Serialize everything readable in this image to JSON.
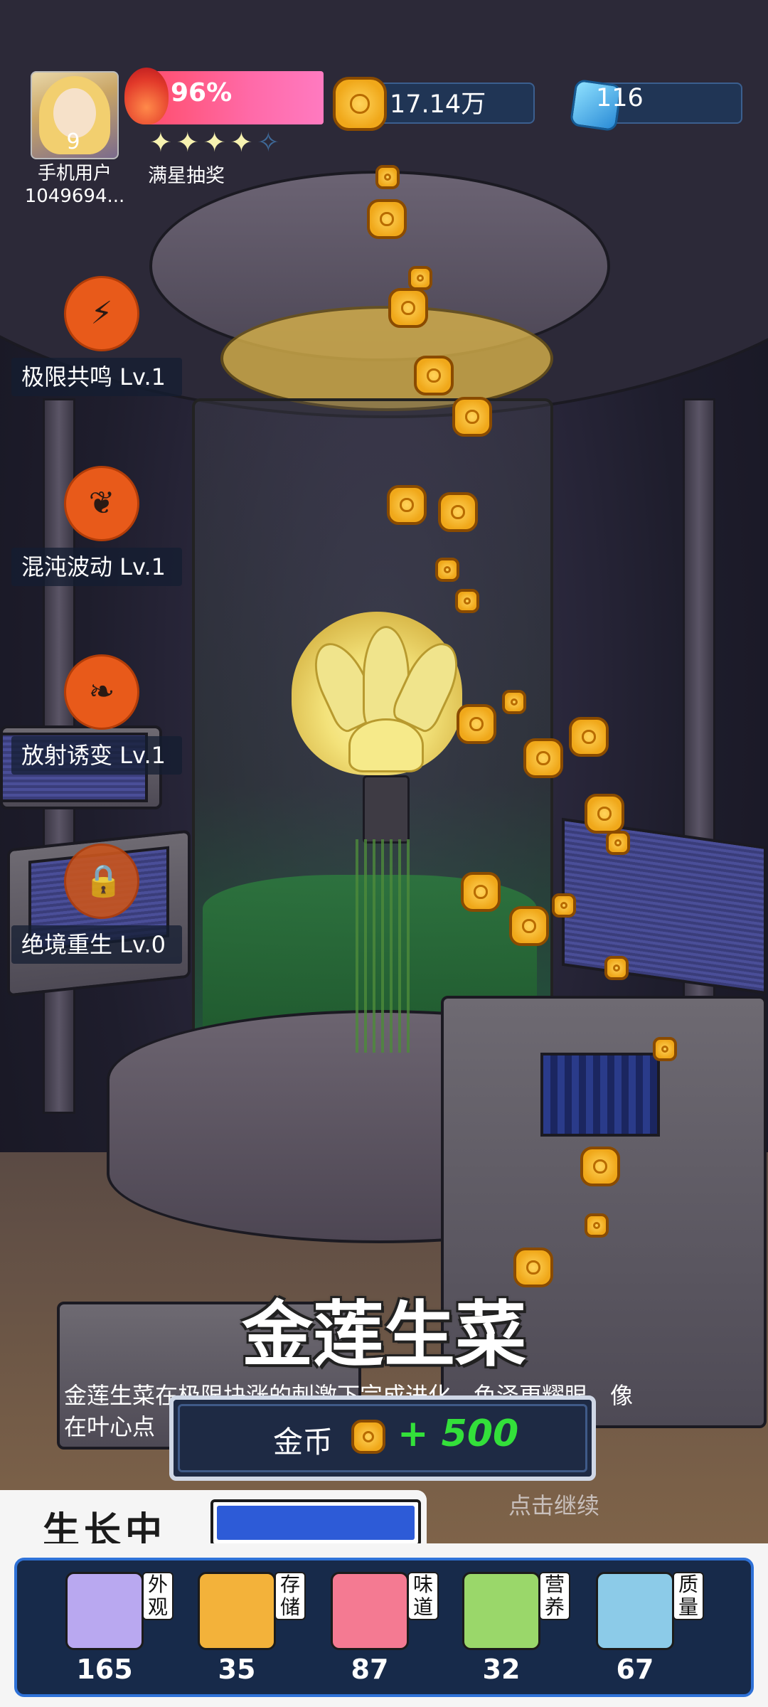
{
  "player": {
    "level": "9",
    "name_line1": "手机用户",
    "name_line2": "1049694..."
  },
  "energy": {
    "percent_text": "96%",
    "value": 0.96,
    "stars_filled": 4,
    "stars_total": 5,
    "star_filled_glyph": "✦",
    "star_empty_glyph": "✧",
    "lottery_label": "满星抽奖"
  },
  "currency": {
    "gold": "17.14万",
    "gems": "116"
  },
  "skills": [
    {
      "label": "极限共鸣 Lv.1",
      "icon": "thunder-icon",
      "glyph": "⚡"
    },
    {
      "label": "混沌波动 Lv.1",
      "icon": "sprout-dome-icon",
      "glyph": "❦"
    },
    {
      "label": "放射诱变 Lv.1",
      "icon": "sprout-box-icon",
      "glyph": "❧"
    },
    {
      "label": "绝境重生 Lv.0",
      "icon": "lock-icon",
      "glyph": "🔒"
    }
  ],
  "vegetable": {
    "title": "金莲生菜",
    "description_line1": "金莲生菜在极限块涨的刺激下完成进化，色泽更耀眼，像",
    "description_line2": "在叶心点"
  },
  "reward": {
    "label": "金币",
    "value": "+ 500"
  },
  "continue_text": "点击继续",
  "growth": {
    "status": "生长中",
    "progress": 1.0
  },
  "stats": [
    {
      "tag": "外观",
      "value": "165",
      "icon": "sparkle-icon",
      "color": "#b9a8f0"
    },
    {
      "tag": "存储",
      "value": "35",
      "icon": "storage-box-icon",
      "color": "#f3b23a"
    },
    {
      "tag": "味道",
      "value": "87",
      "icon": "fork-knife-icon",
      "color": "#f47a92"
    },
    {
      "tag": "营养",
      "value": "32",
      "icon": "lime-icon",
      "color": "#9ad76a"
    },
    {
      "tag": "质量",
      "value": "67",
      "icon": "muscle-icon",
      "color": "#8ccbe8"
    }
  ],
  "colors": {
    "energy_bar": "#ff6aa8",
    "skill_orange": "#e85a1a",
    "reward_green": "#33e03a",
    "progress_blue": "#2d5bd7"
  }
}
